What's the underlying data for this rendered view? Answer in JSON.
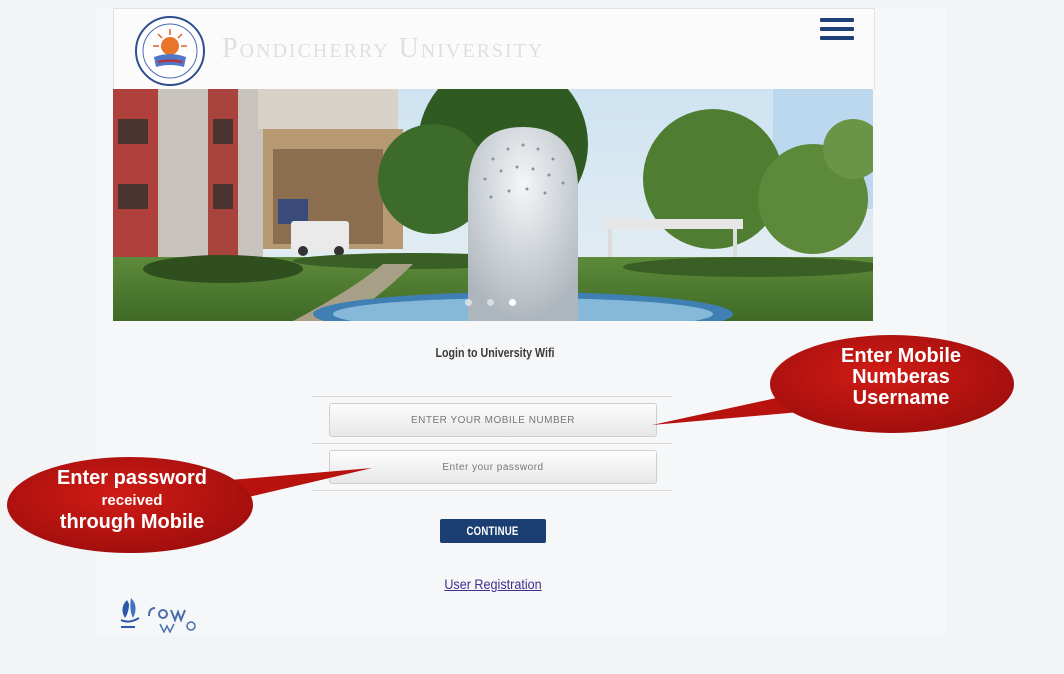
{
  "header": {
    "university_name": "Pondicherry University",
    "logo_icon": "university-seal-icon",
    "menu_icon": "hamburger-menu-icon"
  },
  "banner": {
    "slide_indicators": 3,
    "active_slide": 1
  },
  "login": {
    "title": "Login to University Wifi",
    "mobile_placeholder": "ENTER YOUR MOBILE NUMBER",
    "password_placeholder": "Enter your password",
    "continue_label": "CONTINUE",
    "registration_link": "User Registration"
  },
  "annotations": {
    "mobile_callout": [
      "Enter Mobile",
      "Numberas",
      "Username"
    ],
    "password_callout_top": "Enter password",
    "password_callout_mid": "received",
    "password_callout_bottom": "through Mobile"
  },
  "colors": {
    "accent": "#1b3f73",
    "callout": "#b8120f",
    "link": "#3d2f8a"
  }
}
